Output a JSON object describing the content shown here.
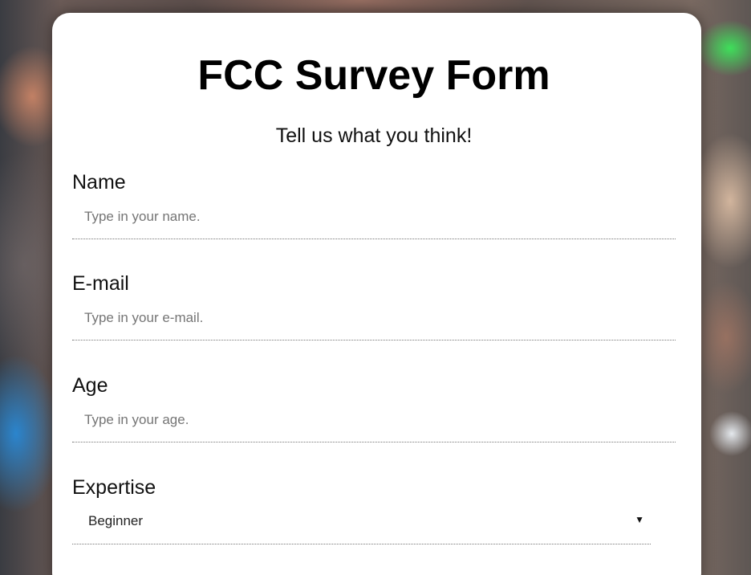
{
  "form": {
    "title": "FCC Survey Form",
    "subtitle": "Tell us what you think!",
    "name": {
      "label": "Name",
      "placeholder": "Type in your name.",
      "value": ""
    },
    "email": {
      "label": "E-mail",
      "placeholder": "Type in your e-mail.",
      "value": ""
    },
    "age": {
      "label": "Age",
      "placeholder": "Type in your age.",
      "value": ""
    },
    "expertise": {
      "label": "Expertise",
      "selected": "Beginner",
      "arrow": "▼"
    }
  },
  "icons": {
    "dropdown": "caret-down-icon"
  }
}
